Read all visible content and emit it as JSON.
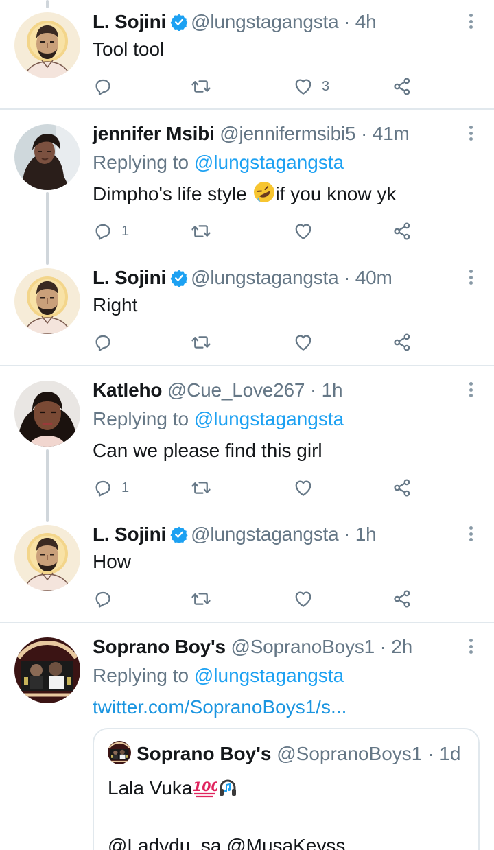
{
  "colors": {
    "link": "#1da1f2",
    "secondary_text": "#657786",
    "separator": "#e1e8ed",
    "verified": "#1da1f2"
  },
  "tweets": [
    {
      "name": "L. Sojini",
      "verified": true,
      "handle": "@lungstagangsta",
      "dot": "·",
      "time": "4h",
      "text": "Tool tool",
      "reply_count": "",
      "like_count": "3"
    },
    {
      "name": "jennifer Msibi",
      "verified": false,
      "handle": "@jennifermsibi5",
      "dot": "·",
      "time": "41m",
      "replying_prefix": "Replying to",
      "replying_to": "@lungstagangsta",
      "text_before_emoji": "Dimpho's life style ",
      "emoji": "rolling-on-floor-laughing",
      "text_after_emoji": "if you know yk",
      "reply_count": "1",
      "like_count": ""
    },
    {
      "name": "L. Sojini",
      "verified": true,
      "handle": "@lungstagangsta",
      "dot": "·",
      "time": "40m",
      "text": "Right",
      "reply_count": "",
      "like_count": ""
    },
    {
      "name": "Katleho",
      "verified": false,
      "handle": "@Cue_Love267",
      "dot": "·",
      "time": "1h",
      "replying_prefix": "Replying to",
      "replying_to": "@lungstagangsta",
      "text": "Can we please find this girl",
      "reply_count": "1",
      "like_count": ""
    },
    {
      "name": "L. Sojini",
      "verified": true,
      "handle": "@lungstagangsta",
      "dot": "·",
      "time": "1h",
      "text": "How",
      "reply_count": "",
      "like_count": ""
    },
    {
      "name": "Soprano Boy's",
      "verified": false,
      "handle": "@SopranoBoys1",
      "dot": "·",
      "time": "2h",
      "replying_prefix": "Replying to",
      "replying_to": "@lungstagangsta",
      "link_text": "twitter.com/SopranoBoys1/s...",
      "quote": {
        "name": "Soprano Boy's",
        "handle": "@SopranoBoys1",
        "dot": "·",
        "time": "1d",
        "text": "Lala Vuka",
        "emojis": [
          "hundred-points",
          "headphones"
        ],
        "mentions": "@Ladydu_sa @MusaKeyss"
      }
    }
  ]
}
